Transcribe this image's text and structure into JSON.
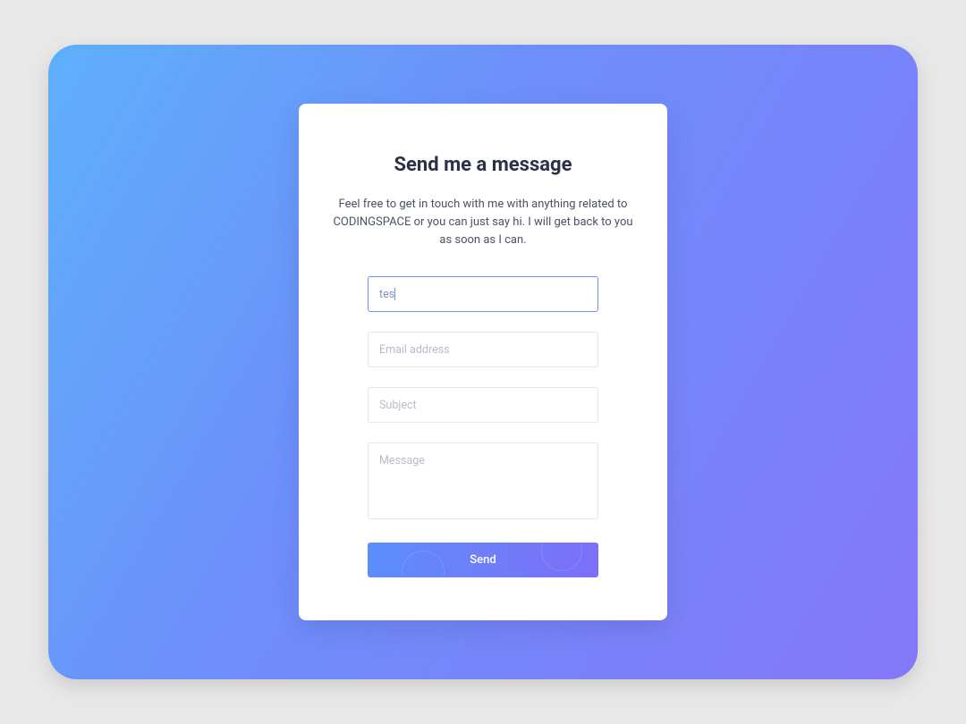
{
  "form": {
    "title": "Send me a message",
    "description": "Feel free to get in touch with me with anything related to CODINGSPACE or you can just say hi. I will get back to you as soon as I can.",
    "name_value": "tes",
    "email_placeholder": "Email address",
    "subject_placeholder": "Subject",
    "message_placeholder": "Message",
    "send_label": "Send"
  }
}
